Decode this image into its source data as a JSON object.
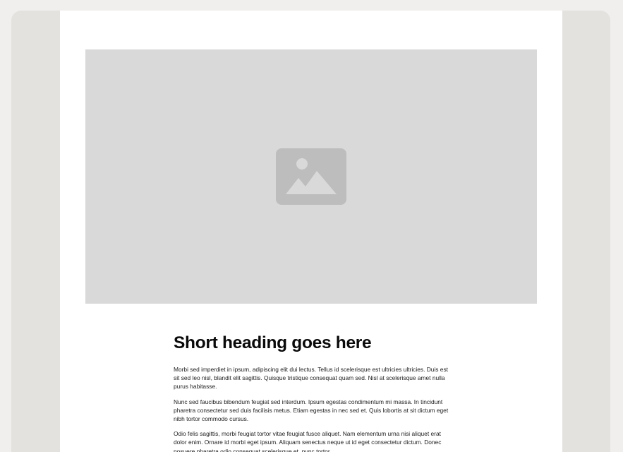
{
  "hero": {
    "icon": "image-placeholder-icon",
    "colors": {
      "background": "#d9d9d9",
      "icon": "#bdbdbd"
    }
  },
  "article": {
    "heading": "Short heading goes here",
    "paragraphs": [
      "Morbi sed imperdiet in ipsum, adipiscing elit dui lectus. Tellus id scelerisque est ultricies ultricies. Duis est sit sed leo nisl, blandit elit sagittis. Quisque tristique consequat quam sed. Nisl at scelerisque amet nulla purus habitasse.",
      "Nunc sed faucibus bibendum feugiat sed interdum. Ipsum egestas condimentum mi massa. In tincidunt pharetra consectetur sed duis facilisis metus. Etiam egestas in nec sed et. Quis lobortis at sit dictum eget nibh tortor commodo cursus.",
      "Odio felis sagittis, morbi feugiat tortor vitae feugiat fusce aliquet. Nam elementum urna nisi aliquet erat dolor enim. Ornare id morbi eget ipsum. Aliquam senectus neque ut id eget consectetur dictum. Donec posuere pharetra odio consequat scelerisque et, nunc tortor."
    ]
  },
  "colors": {
    "app_background": "#f0efed",
    "frame": "#e3e2df",
    "page": "#ffffff",
    "text": "#0a0a0a"
  }
}
